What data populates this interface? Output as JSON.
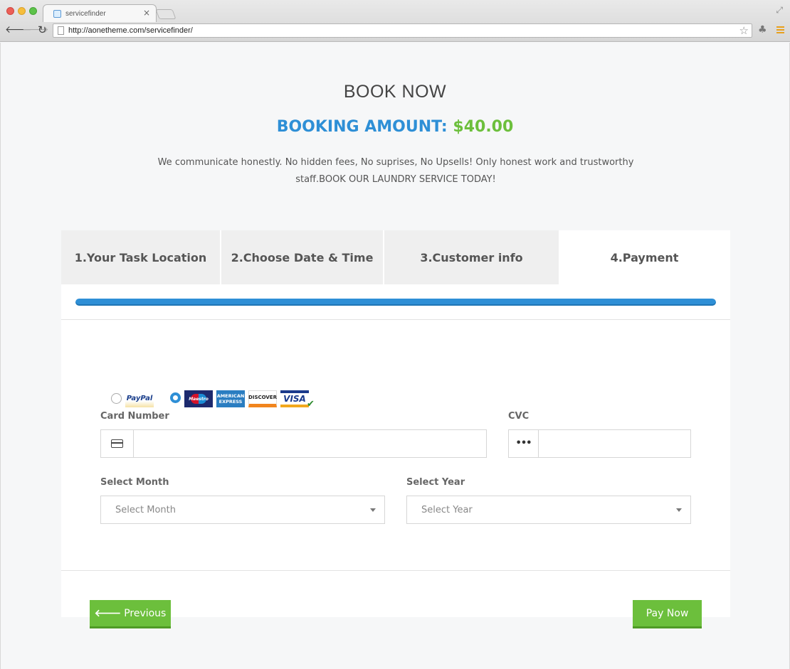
{
  "browser": {
    "tab_title": "servicefinder",
    "tab_close": "×",
    "url": "http://aonetheme.com/servicefinder/"
  },
  "header": {
    "title": "BOOK NOW",
    "amount_label": "BOOKING AMOUNT:",
    "amount_value": "$40.00",
    "tagline": "We communicate honestly. No hidden fees, No suprises, No Upsells! Only honest work and trustworthy staff.BOOK OUR LAUNDRY SERVICE TODAY!"
  },
  "steps": [
    {
      "label": "1.Your Task Location",
      "active": false
    },
    {
      "label": "2.Choose Date & Time",
      "active": false
    },
    {
      "label": "3.Customer info",
      "active": false
    },
    {
      "label": "4.Payment",
      "active": true
    }
  ],
  "progress": {
    "percent": 100,
    "color": "#2e8fd6"
  },
  "payment": {
    "paypal_logo": "PayPal",
    "selected_method": "card",
    "cards": {
      "maestro": "Maestro",
      "amex": "AMERICAN EXPRESS",
      "discover": "DISCOVER",
      "visa": "VISA"
    }
  },
  "form": {
    "card_number_label": "Card Number",
    "card_number_value": "",
    "cvc_label": "CVC",
    "cvc_value": "",
    "month_label": "Select Month",
    "month_value": "Select Month",
    "year_label": "Select Year",
    "year_value": "Select Year"
  },
  "buttons": {
    "previous": "Previous",
    "pay_now": "Pay Now"
  },
  "colors": {
    "accent_blue": "#2e8fd6",
    "accent_green": "#6cbf3c"
  }
}
